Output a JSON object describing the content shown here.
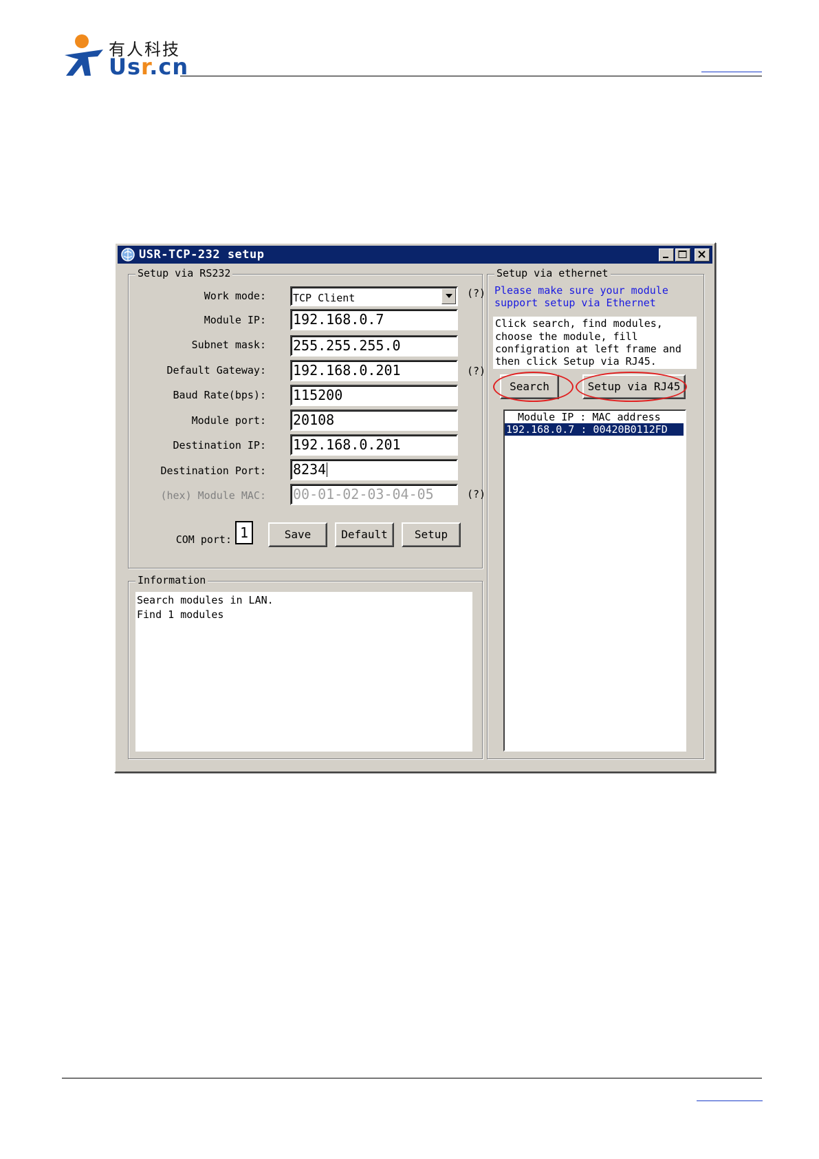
{
  "header": {
    "brand_cn": "有人科技",
    "brand_en_left": "Us",
    "brand_en_r": "r",
    "brand_en_right": ".cn"
  },
  "window": {
    "title": "USR-TCP-232 setup",
    "icon": "app-globe-icon",
    "controls": [
      "minimize-icon",
      "maximize-icon",
      "close-icon"
    ]
  },
  "rs232": {
    "group_label": "Setup via RS232",
    "work_mode_label": "Work mode:",
    "work_mode_value": "TCP Client",
    "module_ip_label": "Module IP:",
    "module_ip_value": "192.168.0.7",
    "subnet_label": "Subnet mask:",
    "subnet_value": "255.255.255.0",
    "gateway_label": "Default Gateway:",
    "gateway_value": "192.168.0.201",
    "baud_label": "Baud Rate(bps):",
    "baud_value": "115200",
    "module_port_label": "Module port:",
    "module_port_value": "20108",
    "dest_ip_label": "Destination IP:",
    "dest_ip_value": "192.168.0.201",
    "dest_port_label": "Destination Port:",
    "dest_port_value": "8234",
    "mac_label": "(hex) Module MAC:",
    "mac_value": "00-01-02-03-04-05",
    "help": "(?)",
    "com_port_label": "COM port:",
    "com_port_value": "1",
    "save_label": "Save",
    "default_label": "Default",
    "setup_label": "Setup"
  },
  "information": {
    "group_label": "Information",
    "line1": "Search modules in LAN.",
    "line2": "Find 1 modules"
  },
  "ethernet": {
    "group_label": "Setup via ethernet",
    "note_line1": "Please make sure your module",
    "note_line2": "support setup via Ethernet",
    "hint_line1": "Click search, find modules,",
    "hint_line2": "choose the module, fill",
    "hint_line3": "configration at left frame and",
    "hint_line4": "then click Setup via RJ45.",
    "search_label": "Search",
    "setup_rj45_label": "Setup via RJ45",
    "list_header": "Module IP : MAC address",
    "list_rows": [
      "192.168.0.7 : 00420B0112FD"
    ]
  },
  "colors": {
    "title_bar": "#0a246a",
    "dialog_face": "#d4d0c8",
    "highlight_ellipse": "#e02020",
    "note_text": "#1a1ae0",
    "brand_blue": "#1a4fa3",
    "brand_orange": "#f08a1c"
  }
}
